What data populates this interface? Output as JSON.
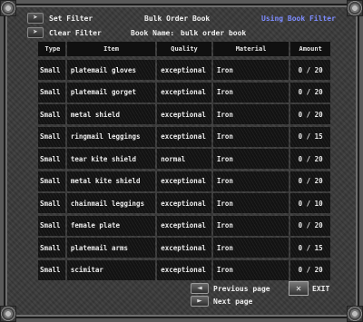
{
  "header": {
    "set_filter": "Set Filter",
    "clear_filter": "Clear Filter",
    "title": "Bulk Order Book",
    "filter_status": "Using Book Filter",
    "book_name_label": "Book Name:",
    "book_name": "bulk order book"
  },
  "table": {
    "columns": [
      "Type",
      "Item",
      "Quality",
      "Material",
      "Amount"
    ],
    "rows": [
      {
        "type": "Small",
        "item": "platemail gloves",
        "quality": "exceptional",
        "material": "Iron",
        "amount": "0 / 20"
      },
      {
        "type": "Small",
        "item": "platemail gorget",
        "quality": "exceptional",
        "material": "Iron",
        "amount": "0 / 20"
      },
      {
        "type": "Small",
        "item": "metal shield",
        "quality": "exceptional",
        "material": "Iron",
        "amount": "0 / 20"
      },
      {
        "type": "Small",
        "item": "ringmail leggings",
        "quality": "exceptional",
        "material": "Iron",
        "amount": "0 / 15"
      },
      {
        "type": "Small",
        "item": "tear kite shield",
        "quality": "normal",
        "material": "Iron",
        "amount": "0 / 20"
      },
      {
        "type": "Small",
        "item": "metal kite shield",
        "quality": "exceptional",
        "material": "Iron",
        "amount": "0 / 20"
      },
      {
        "type": "Small",
        "item": "chainmail leggings",
        "quality": "exceptional",
        "material": "Iron",
        "amount": "0 / 10"
      },
      {
        "type": "Small",
        "item": "female plate",
        "quality": "exceptional",
        "material": "Iron",
        "amount": "0 / 20"
      },
      {
        "type": "Small",
        "item": "platemail arms",
        "quality": "exceptional",
        "material": "Iron",
        "amount": "0 / 15"
      },
      {
        "type": "Small",
        "item": "scimitar",
        "quality": "exceptional",
        "material": "Iron",
        "amount": "0 / 20"
      }
    ]
  },
  "footer": {
    "previous_page": "Previous page",
    "next_page": "Next page",
    "exit": "EXIT"
  },
  "colors": {
    "accent_blue": "#7d8cff"
  }
}
